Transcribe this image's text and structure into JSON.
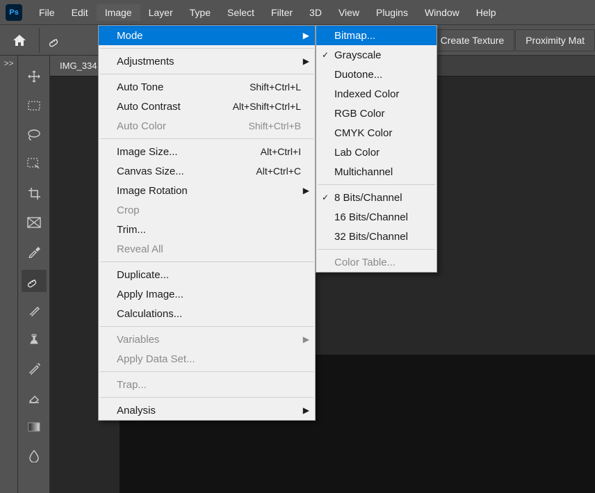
{
  "logo": "Ps",
  "menubar": [
    "File",
    "Edit",
    "Image",
    "Layer",
    "Type",
    "Select",
    "Filter",
    "3D",
    "View",
    "Plugins",
    "Window",
    "Help"
  ],
  "menubar_active": "Image",
  "options_right": [
    "Create Texture",
    "Proximity Mat"
  ],
  "left_collapse": ">>",
  "document_tab": "IMG_334",
  "image_menu": {
    "mode": "Mode",
    "adjustments": "Adjustments",
    "auto_tone": "Auto Tone",
    "sc_auto_tone": "Shift+Ctrl+L",
    "auto_contrast": "Auto Contrast",
    "sc_auto_contrast": "Alt+Shift+Ctrl+L",
    "auto_color": "Auto Color",
    "sc_auto_color": "Shift+Ctrl+B",
    "image_size": "Image Size...",
    "sc_image_size": "Alt+Ctrl+I",
    "canvas_size": "Canvas Size...",
    "sc_canvas_size": "Alt+Ctrl+C",
    "image_rotation": "Image Rotation",
    "crop": "Crop",
    "trim": "Trim...",
    "reveal_all": "Reveal All",
    "duplicate": "Duplicate...",
    "apply_image": "Apply Image...",
    "calculations": "Calculations...",
    "variables": "Variables",
    "apply_data_set": "Apply Data Set...",
    "trap": "Trap...",
    "analysis": "Analysis"
  },
  "mode_menu": {
    "bitmap": "Bitmap...",
    "grayscale": "Grayscale",
    "duotone": "Duotone...",
    "indexed": "Indexed Color",
    "rgb": "RGB Color",
    "cmyk": "CMYK Color",
    "lab": "Lab Color",
    "multichannel": "Multichannel",
    "bits8": "8 Bits/Channel",
    "bits16": "16 Bits/Channel",
    "bits32": "32 Bits/Channel",
    "color_table": "Color Table..."
  }
}
